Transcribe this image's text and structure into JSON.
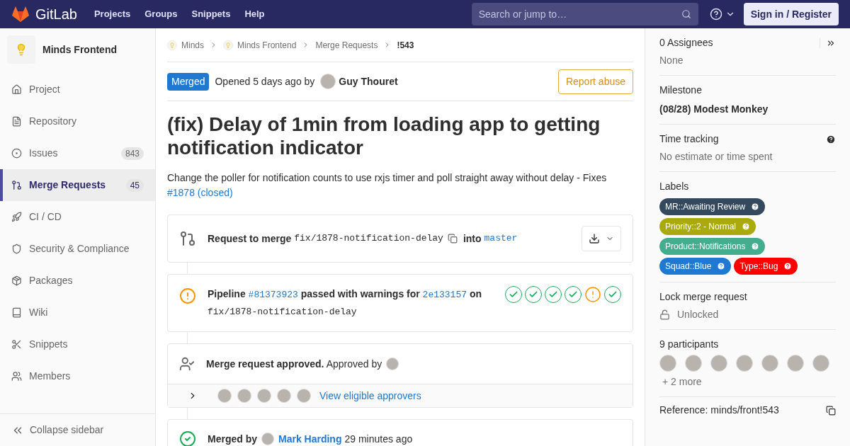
{
  "navbar": {
    "logo": "GitLab",
    "links": [
      "Projects",
      "Groups",
      "Snippets",
      "Help"
    ],
    "search": {
      "placeholder": "Search or jump to…"
    },
    "sign_in": "Sign in / Register"
  },
  "sidebar": {
    "project": "Minds Frontend",
    "items": [
      {
        "label": "Project",
        "selected": false
      },
      {
        "label": "Repository",
        "selected": false
      },
      {
        "label": "Issues",
        "count": "843",
        "selected": false
      },
      {
        "label": "Merge Requests",
        "count": "45",
        "selected": true
      },
      {
        "label": "CI / CD",
        "selected": false
      },
      {
        "label": "Security & Compliance",
        "selected": false
      },
      {
        "label": "Packages",
        "selected": false
      },
      {
        "label": "Wiki",
        "selected": false
      },
      {
        "label": "Snippets",
        "selected": false
      },
      {
        "label": "Members",
        "selected": false
      }
    ],
    "collapse": "Collapse sidebar"
  },
  "breadcrumbs": [
    "Minds",
    "Minds Frontend",
    "Merge Requests",
    "!543"
  ],
  "header": {
    "status": "Merged",
    "opened": "Opened 5 days ago by",
    "author": "Guy Thouret",
    "report": "Report abuse"
  },
  "title": "(fix) Delay of 1min from loading app to getting notification indicator",
  "description": "Change the poller for notification counts to use rxjs timer and poll straight away without delay - Fixes",
  "description_link": "#1878 (closed)",
  "merge_box": {
    "prefix": "Request to merge",
    "source": "fix/1878-notification-delay",
    "into": "into",
    "target": "master"
  },
  "pipeline": {
    "prefix": "Pipeline",
    "id": "#81373923",
    "status": "passed with warnings for",
    "commit": "2e133157",
    "on": "on",
    "branch": "fix/1878-notification-delay",
    "stages": [
      {
        "kind": "success"
      },
      {
        "kind": "success"
      },
      {
        "kind": "success"
      },
      {
        "kind": "success"
      },
      {
        "kind": "warning"
      },
      {
        "kind": "success"
      }
    ]
  },
  "approval": {
    "bold": "Merge request approved.",
    "text": "Approved by",
    "approvers_link": "View eligible approvers"
  },
  "merged": {
    "prefix": "Merged by",
    "user": "Mark Harding",
    "time": "29 minutes ago"
  },
  "right_sidebar": {
    "assignees": {
      "title": "0 Assignees",
      "value": "None"
    },
    "milestone": {
      "title": "Milestone",
      "value": "(08/28) Modest Monkey"
    },
    "time_tracking": {
      "title": "Time tracking",
      "value": "No estimate or time spent"
    },
    "labels": {
      "title": "Labels",
      "items": [
        {
          "text": "MR::Awaiting Review",
          "color": "#34495e"
        },
        {
          "text": "Priority::2 - Normal",
          "color": "#aaaa0f"
        },
        {
          "text": "Product::Notifications",
          "color": "#44ad8e"
        },
        {
          "text": "Squad::Blue",
          "color": "#1f78d1"
        },
        {
          "text": "Type::Bug",
          "color": "#ff0000"
        }
      ]
    },
    "lock": {
      "title": "Lock merge request",
      "value": "Unlocked"
    },
    "participants": {
      "title": "9 participants",
      "more": "+ 2 more"
    },
    "reference": "Reference: minds/front!543"
  }
}
